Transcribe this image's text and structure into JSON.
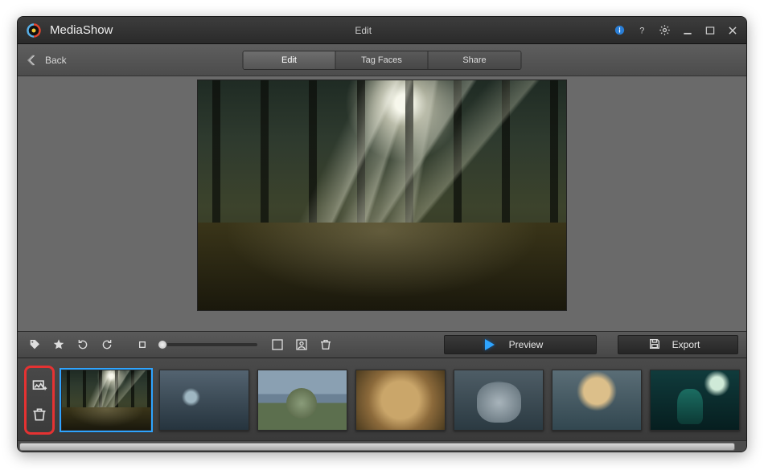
{
  "app": {
    "name": "MediaShow",
    "window_title": "Edit"
  },
  "titlebar_icons": {
    "info": "info-icon",
    "help": "help-icon",
    "settings": "gear-icon",
    "minimize": "minimize-icon",
    "maximize": "maximize-icon",
    "close": "close-icon"
  },
  "nav": {
    "back": "Back"
  },
  "tabs": [
    {
      "label": "Edit",
      "active": true
    },
    {
      "label": "Tag Faces",
      "active": false
    },
    {
      "label": "Share",
      "active": false
    }
  ],
  "toolbar": {
    "tag": "tag-icon",
    "favorite": "star-icon",
    "rotate_left": "rotate-left-icon",
    "rotate_right": "rotate-right-icon",
    "zoom_thumb_small": "thumb-small-icon",
    "zoom_thumb_large": "thumb-large-icon",
    "slideshow": "slideshow-icon",
    "face_tag": "face-tag-icon",
    "delete": "trash-icon",
    "zoom_value": 0
  },
  "actions": {
    "preview": "Preview",
    "export": "Export"
  },
  "thumb_tools": {
    "add": "add-media-icon",
    "remove": "trash-icon"
  },
  "thumbnails": [
    {
      "selected": true,
      "name": "thumb-1"
    },
    {
      "selected": false,
      "name": "thumb-2"
    },
    {
      "selected": false,
      "name": "thumb-3"
    },
    {
      "selected": false,
      "name": "thumb-4"
    },
    {
      "selected": false,
      "name": "thumb-5"
    },
    {
      "selected": false,
      "name": "thumb-6"
    },
    {
      "selected": false,
      "name": "thumb-7"
    }
  ],
  "colors": {
    "accent": "#2ea4ff",
    "highlight_ring": "#e53232"
  }
}
